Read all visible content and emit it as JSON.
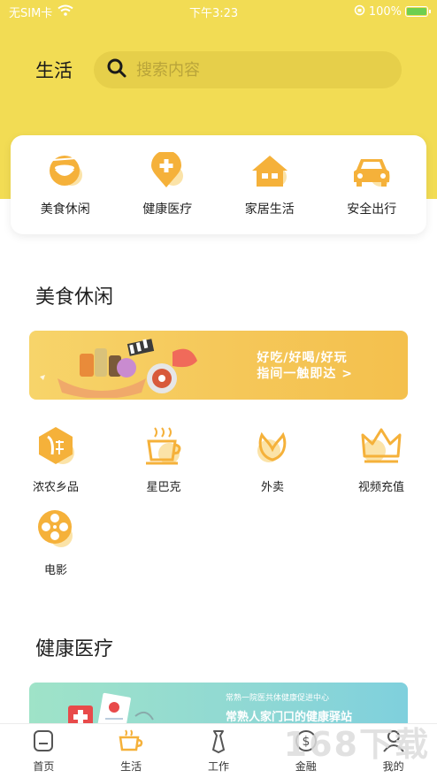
{
  "status_bar": {
    "carrier": "无SIM卡",
    "time": "下午3:23",
    "battery": "100%"
  },
  "header": {
    "title": "生活",
    "search_placeholder": "搜索内容"
  },
  "categories": [
    {
      "label": "美食休闲",
      "icon": "food-bowl-icon"
    },
    {
      "label": "健康医疗",
      "icon": "medical-pin-icon"
    },
    {
      "label": "家居生活",
      "icon": "house-icon"
    },
    {
      "label": "安全出行",
      "icon": "car-icon"
    }
  ],
  "section_food": {
    "title": "美食休闲",
    "banner_line1": "好吃/好喝/好玩",
    "banner_line2": "指间一触即达 >",
    "items": [
      {
        "label": "浓农乡品",
        "icon": "farm-hexagon-icon"
      },
      {
        "label": "星巴克",
        "icon": "coffee-cup-icon"
      },
      {
        "label": "外卖",
        "icon": "lotus-icon"
      },
      {
        "label": "视频充值",
        "icon": "crown-icon"
      },
      {
        "label": "电影",
        "icon": "film-reel-icon"
      }
    ]
  },
  "section_health": {
    "title": "健康医疗",
    "banner_small": "常熟一院医共体健康促进中心",
    "banner_big": "常熟人家门口的健康驿站"
  },
  "tabbar": [
    {
      "label": "首页",
      "icon": "home-icon"
    },
    {
      "label": "生活",
      "icon": "coffee-tab-icon"
    },
    {
      "label": "工作",
      "icon": "tie-icon"
    },
    {
      "label": "金融",
      "icon": "dollar-icon"
    },
    {
      "label": "我的",
      "icon": "user-icon"
    }
  ],
  "watermark": "168下载",
  "colors": {
    "header_bg": "#f2dc54",
    "accent": "#f5b13a",
    "icon_light": "#fbe3a8"
  }
}
